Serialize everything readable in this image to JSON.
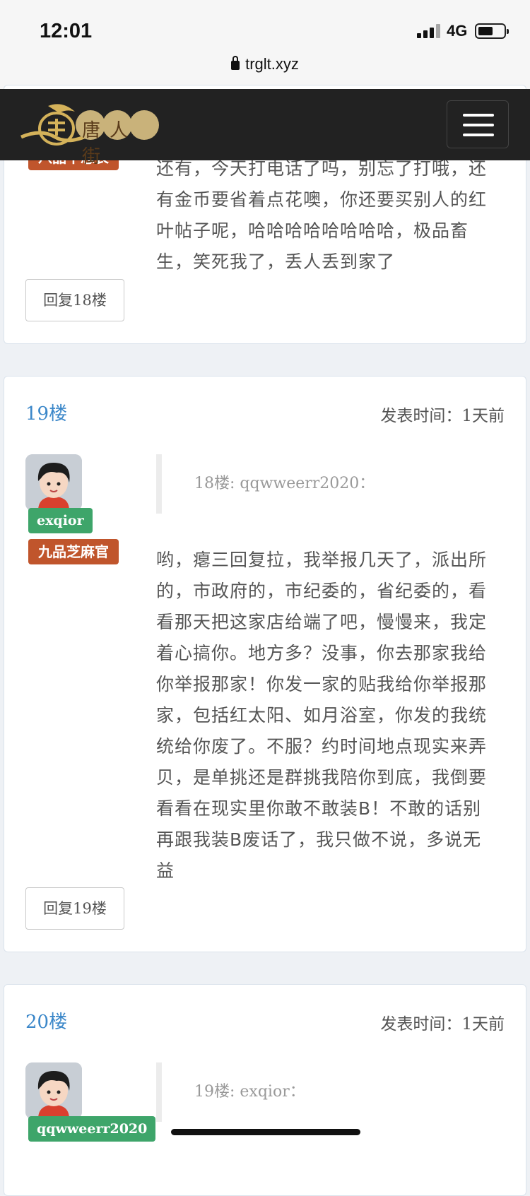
{
  "status_bar": {
    "time": "12:01",
    "network": "4G"
  },
  "browser": {
    "url": "trglt.xyz"
  },
  "navbar": {
    "logo_text": "唐人街"
  },
  "posts": [
    {
      "rank": "八品干总长",
      "body": "还有，今天打电话了吗，别忘了打哦，还有金币要省着点花噢，你还要买别人的红叶帖子呢，哈哈哈哈哈哈哈哈，极品畜生，笑死我了，丢人丢到家了",
      "reply_label": "回复18楼"
    },
    {
      "floor": "19楼",
      "post_time": "发表时间：1天前",
      "username": "exqior",
      "rank": "九品芝麻官",
      "quote": "18楼: qqwweerr2020：",
      "body": "哟，瘪三回复拉，我举报几天了，派出所的，市政府的，市纪委的，省纪委的，看看那天把这家店给端了吧，慢慢来，我定着心搞你。地方多？没事，你去那家我给你举报那家！你发一家的贴我给你举报那家，包括红太阳、如月浴室，你发的我统统给你废了。不服？约时间地点现实来弄贝，是单挑还是群挑我陪你到底，我倒要看看在现实里你敢不敢装B！不敢的话别再跟我装B废话了，我只做不说，多说无益",
      "reply_label": "回复19楼"
    },
    {
      "floor": "20楼",
      "post_time": "发表时间：1天前",
      "username": "qqwweerr2020",
      "quote": "19楼: exqior："
    }
  ]
}
